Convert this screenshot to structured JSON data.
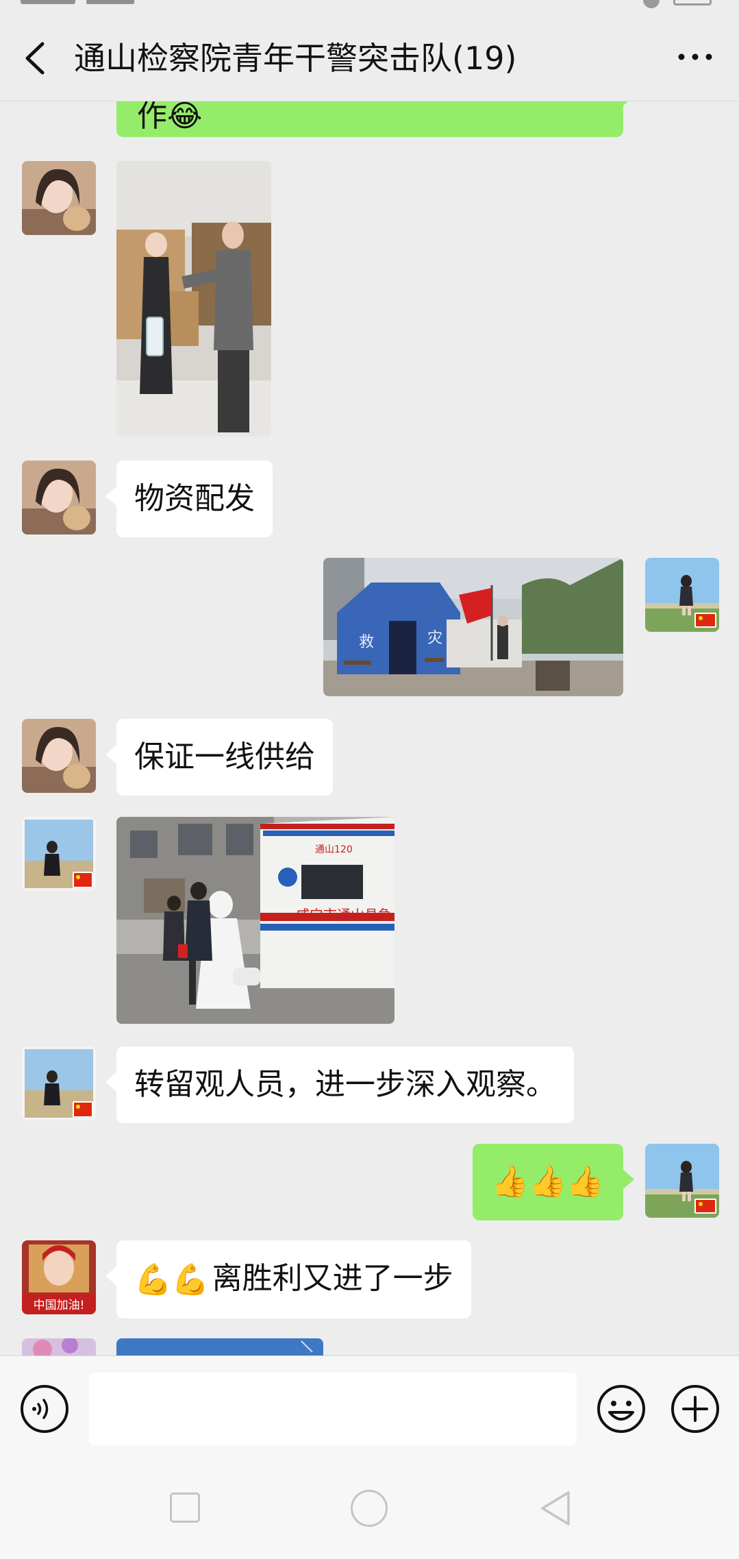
{
  "header": {
    "title": "通山检察院青年干警突击队(19)"
  },
  "messages": {
    "m1_partial": "作😂",
    "m3_text": "物资配发",
    "m5_text": "保证一线供给",
    "m7_text": "转留观人员，进一步深入观察。",
    "m8_text": "👍👍👍",
    "m9_text": "离胜利又进了一步",
    "m9_prefix": "💪💪"
  },
  "photos": {
    "tent_labels": [
      "救",
      "灾"
    ],
    "ambulance_labels": [
      "通山120",
      "咸宁市通山县急"
    ]
  },
  "avatars": {
    "china_badge": "中国加油!"
  },
  "input": {
    "placeholder": "",
    "value": ""
  },
  "colors": {
    "background": "#ededed",
    "bubble_out": "#95ec69",
    "bubble_in": "#ffffff"
  }
}
